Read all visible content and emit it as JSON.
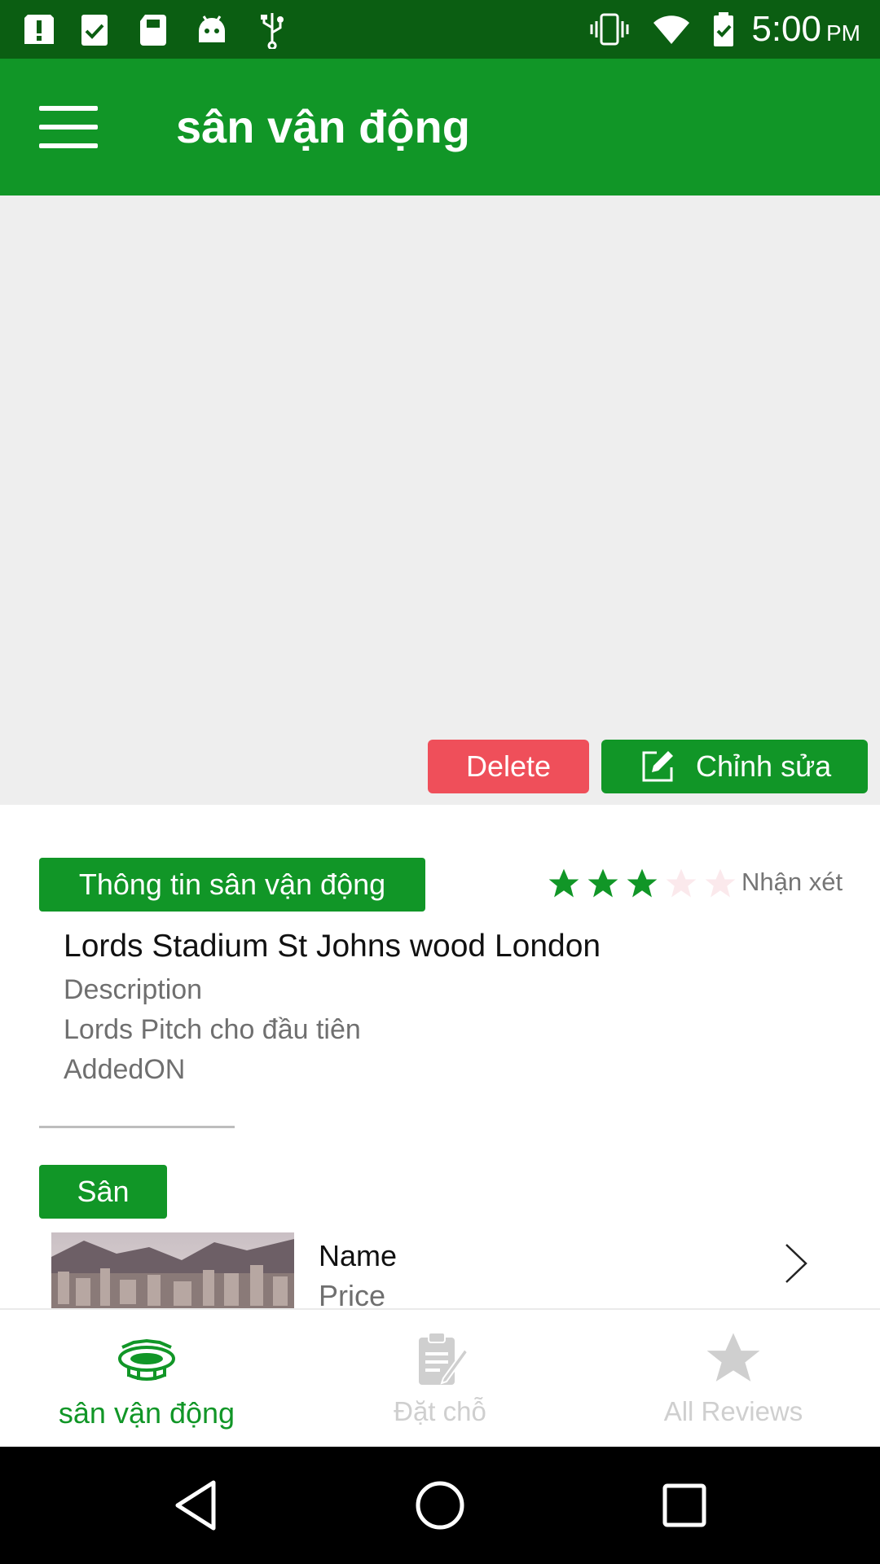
{
  "status_bar": {
    "time": "5:00",
    "ampm": "PM",
    "icons": [
      "alert-icon",
      "clipboard-check-icon",
      "sd-card-icon",
      "android-icon",
      "usb-icon",
      "vibrate-icon",
      "wifi-icon",
      "battery-icon"
    ]
  },
  "app_bar": {
    "title": "sân vận động",
    "menu_icon": "menu-icon"
  },
  "hero": {
    "delete_label": "Delete",
    "edit_label": "Chỉnh sửa",
    "colors": {
      "delete": "#ef4f5a",
      "edit": "#119627"
    }
  },
  "info": {
    "section_label": "Thông tin sân vận động",
    "rating_value": 3,
    "rating_max": 5,
    "review_label": "Nhận xét",
    "stadium_name": "Lords Stadium St Johns wood London",
    "description_label": "Description",
    "description_value": "Lords Pitch cho đầu tiên",
    "added_on_label": "AddedON"
  },
  "pitches": {
    "section_label": "Sân",
    "items": [
      {
        "name": "Name",
        "price": "Price"
      }
    ]
  },
  "bottom_nav": {
    "items": [
      {
        "label": "sân vận động",
        "icon": "stadium-icon",
        "active": true
      },
      {
        "label": "Đặt chỗ",
        "icon": "booking-icon",
        "active": false
      },
      {
        "label": "All Reviews",
        "icon": "star-icon",
        "active": false
      }
    ]
  },
  "colors": {
    "primary": "#119627",
    "status_bar": "#0b5e12",
    "star_filled": "#119627",
    "star_empty": "#fbe9ec"
  }
}
